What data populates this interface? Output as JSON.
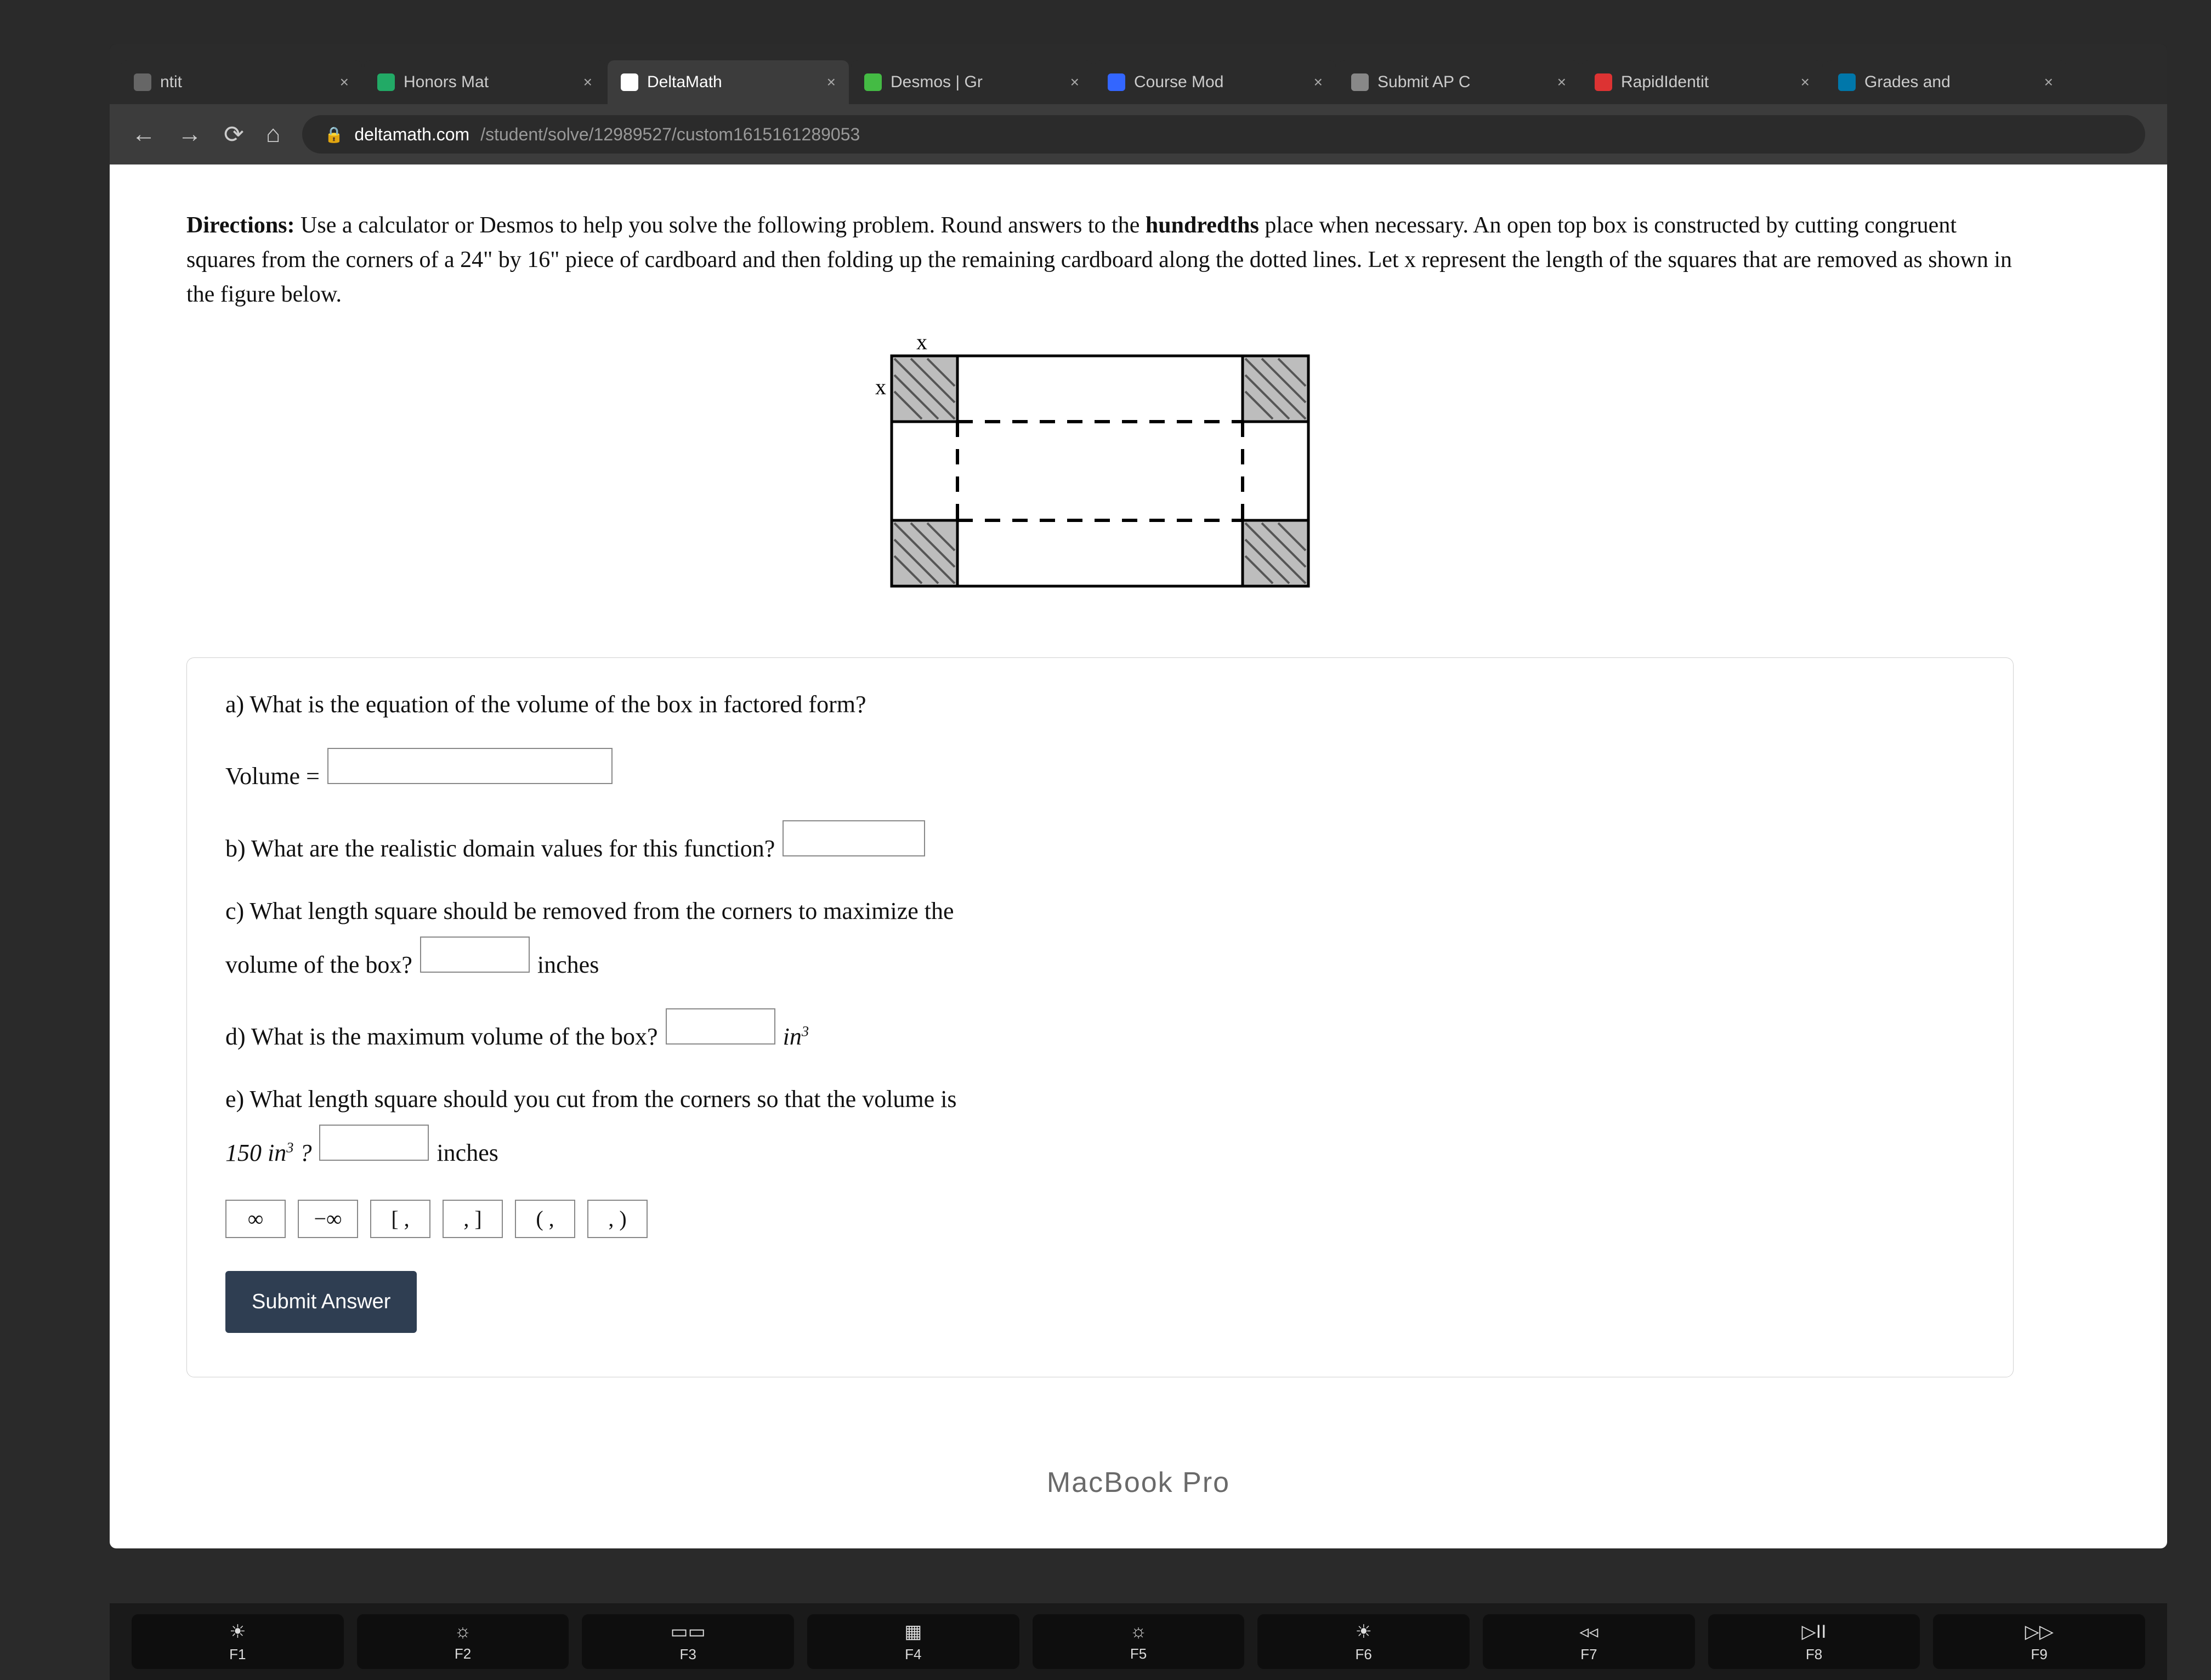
{
  "tabs": [
    {
      "label": "ntit",
      "active": false,
      "favicon": "#666"
    },
    {
      "label": "Honors Mat",
      "active": false,
      "favicon": "#2a6"
    },
    {
      "label": "DeltaMath",
      "active": true,
      "favicon": "#fff"
    },
    {
      "label": "Desmos | Gr",
      "active": false,
      "favicon": "#4b4"
    },
    {
      "label": "Course Mod",
      "active": false,
      "favicon": "#36f"
    },
    {
      "label": "Submit AP C",
      "active": false,
      "favicon": "#888"
    },
    {
      "label": "RapidIdentit",
      "active": false,
      "favicon": "#d33"
    },
    {
      "label": "Grades and",
      "active": false,
      "favicon": "#07a"
    }
  ],
  "url": {
    "domain": "deltamath.com",
    "path": "/student/solve/12989527/custom1615161289053"
  },
  "directions": {
    "label": "Directions:",
    "text": "Use a calculator or Desmos to help you solve the following problem. Round answers to the ",
    "bold": "hundredths",
    "text2": " place when necessary. An open top box is constructed by cutting congruent squares from the corners of a 24\" by 16\" piece of cardboard and then folding up the remaining cardboard along the dotted lines. Let x represent the length of the squares that are removed as shown in the figure below."
  },
  "figure_labels": {
    "x_top": "x",
    "x_side": "x"
  },
  "questions": {
    "a": "a) What is the equation of the volume of the box in factored form?",
    "a_prefix": "Volume =",
    "b": "b) What are the realistic domain values for this function?",
    "c1": "c) What length square should be removed from the corners to maximize the",
    "c2": "volume of the box?",
    "c_unit": "inches",
    "d": "d) What is the maximum volume of the box?",
    "d_unit": "in",
    "d_exp": "3",
    "e1": "e) What length square should you cut from the corners so that the volume is",
    "e2_pre": "150 in",
    "e2_exp": "3",
    "e2_post": " ?",
    "e_unit": "inches"
  },
  "symbol_buttons": [
    "∞",
    "−∞",
    "[ ,",
    ", ]",
    "( ,",
    ", )"
  ],
  "submit_label": "Submit Answer",
  "macbook": "MacBook Pro",
  "keys": [
    {
      "glyph": "☀",
      "label": "F1"
    },
    {
      "glyph": "☼",
      "label": "F2"
    },
    {
      "glyph": "▭▭",
      "label": "F3"
    },
    {
      "glyph": "▦",
      "label": "F4"
    },
    {
      "glyph": "☼",
      "label": "F5"
    },
    {
      "glyph": "☀",
      "label": "F6"
    },
    {
      "glyph": "◃◃",
      "label": "F7"
    },
    {
      "glyph": "▷II",
      "label": "F8"
    },
    {
      "glyph": "▷▷",
      "label": "F9"
    }
  ]
}
